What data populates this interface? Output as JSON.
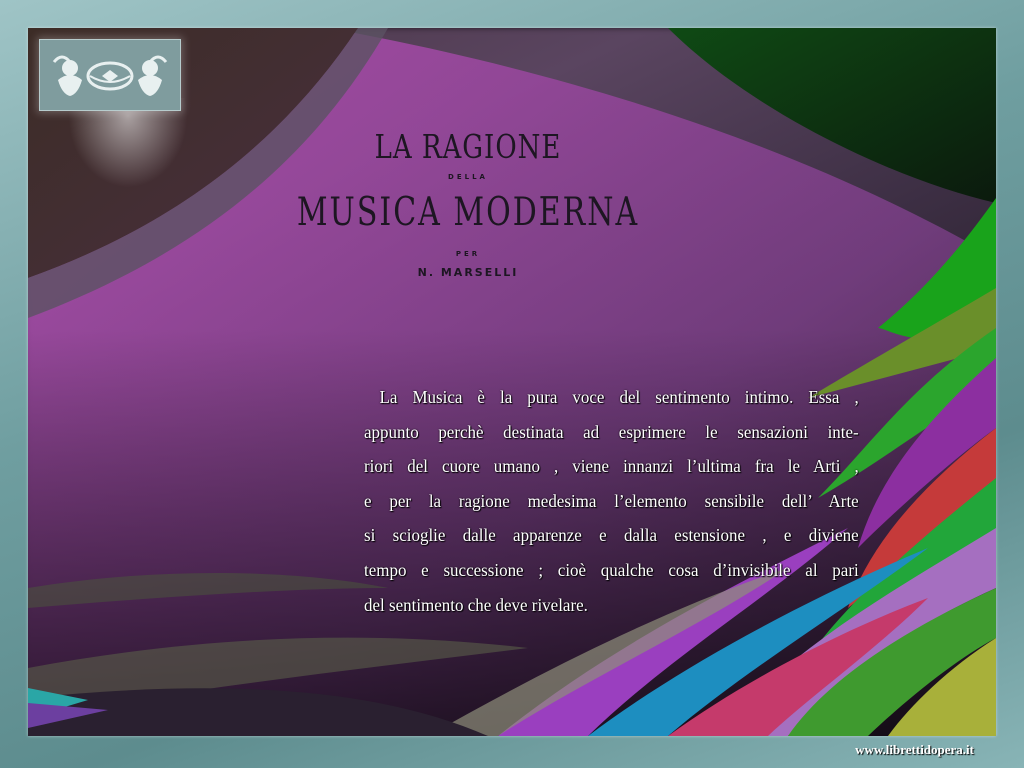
{
  "title": {
    "line1": "LA RAGIONE",
    "della": "DELLA",
    "line2": "MUSICA MODERNA",
    "per": "PER",
    "author": "N. MARSELLI"
  },
  "body": {
    "lines": [
      "La Musica è la pura voce del sentimento intimo. Essa ,",
      "appunto perchè destinata ad esprimere le sensazioni inte-",
      "riori del cuore umano , viene innanzi l’ultima fra le Arti ,",
      "e per la ragione medesima l’elemento sensibile dell’ Arte",
      "si scioglie dalle apparenze e dalla estensione , e diviene",
      "tempo e successione ; cioè qualche cosa d’invisibile al pari",
      "del sentimento che deve rivelare."
    ]
  },
  "footer": {
    "url": "www.librettidopera.it"
  },
  "icons": {
    "emblem": "cherubs-wreath-emblem"
  },
  "colors": {
    "frame": "#7fa9ab",
    "text": "#ffffff",
    "title_ink": "#1d1622"
  }
}
